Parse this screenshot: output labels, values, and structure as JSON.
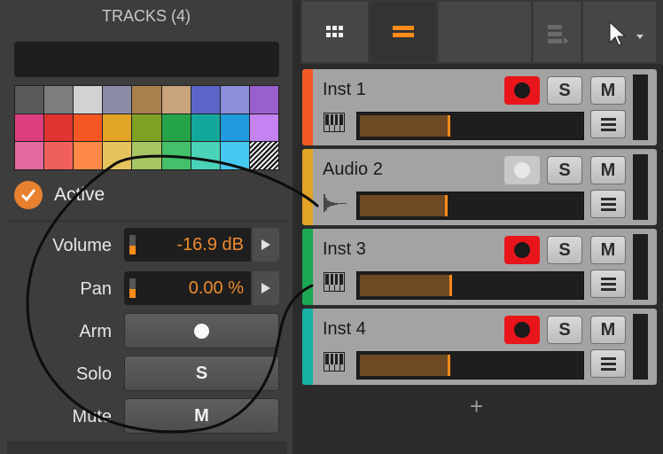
{
  "inspector": {
    "title": "TRACKS (4)",
    "name_value": "",
    "palette": [
      "#595959",
      "#7e7e7e",
      "#d2d2d2",
      "#8b8ba8",
      "#a8804a",
      "#c9a37c",
      "#5b65c9",
      "#8d8fdd",
      "#9a5fcf",
      "#dd3f7e",
      "#e03433",
      "#f55622",
      "#e2a425",
      "#7ea024",
      "#24a34a",
      "#14a89a",
      "#209be0",
      "#c582f1",
      "#e26a9e",
      "#f0605a",
      "#ff8a47",
      "#e5c45e",
      "#a7c563",
      "#44c06a",
      "#4bd3b8",
      "#46c9f2",
      "hatched"
    ],
    "active": {
      "label": "Active",
      "checked": true
    },
    "volume": {
      "label": "Volume",
      "value": "-16.9 dB",
      "level": 0.45
    },
    "pan": {
      "label": "Pan",
      "value": "0.00 %",
      "level": 0.45
    },
    "arm": {
      "label": "Arm"
    },
    "solo": {
      "label": "Solo",
      "button": "S"
    },
    "mute": {
      "label": "Mute",
      "button": "M"
    }
  },
  "toolbar": {
    "icons": [
      "grid-view-icon",
      "list-view-icon",
      "clip-launcher-icon",
      "pointer-tool-icon"
    ]
  },
  "tracks": [
    {
      "name": "Inst 1",
      "color": "#f05a24",
      "type": "instrument",
      "armed": true,
      "solo": "S",
      "mute": "M",
      "volume": 0.4
    },
    {
      "name": "Audio 2",
      "color": "#e2a425",
      "type": "audio",
      "armed": false,
      "solo": "S",
      "mute": "M",
      "volume": 0.39
    },
    {
      "name": "Inst 3",
      "color": "#1aa853",
      "type": "instrument",
      "armed": true,
      "solo": "S",
      "mute": "M",
      "volume": 0.41
    },
    {
      "name": "Inst 4",
      "color": "#16b3a5",
      "type": "instrument",
      "armed": true,
      "solo": "S",
      "mute": "M",
      "volume": 0.4
    }
  ],
  "add_track": "+",
  "colors": {
    "accent": "#ff8c1a",
    "record": "#e8151b",
    "record_off": "#c8c8c8"
  }
}
